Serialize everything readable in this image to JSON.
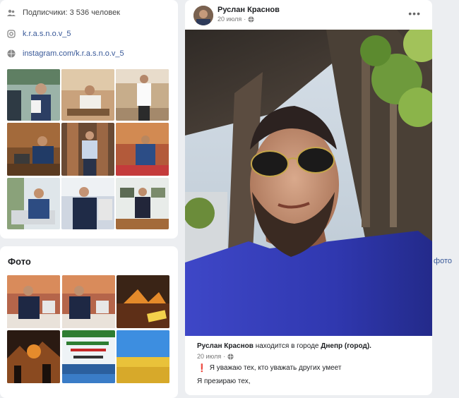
{
  "profile": {
    "subscribers": "Подписчики: 3 536 человек",
    "instagram_handle": "k.r.a.s.n.o.v_5",
    "instagram_link": "instagram.com/k.r.a.s.n.o.v_5"
  },
  "photos_section": {
    "title": "Фото",
    "all_link": "Все фото"
  },
  "post": {
    "author": "Руслан Краснов",
    "date": "20 июля"
  },
  "shared": {
    "author": "Руслан Краснов",
    "verb": " находится в городе ",
    "city": "Днепр (город).",
    "date": "20 июля",
    "line1": "Я уважаю тех, кто уважать других умеет",
    "line2": "Я презираю тех,"
  },
  "colors": {
    "link": "#385898",
    "background": "#eceef1"
  },
  "icons": [
    "people-icon",
    "instagram-icon",
    "globe-icon",
    "globe-small-icon",
    "more-icon",
    "exclamation-icon"
  ]
}
